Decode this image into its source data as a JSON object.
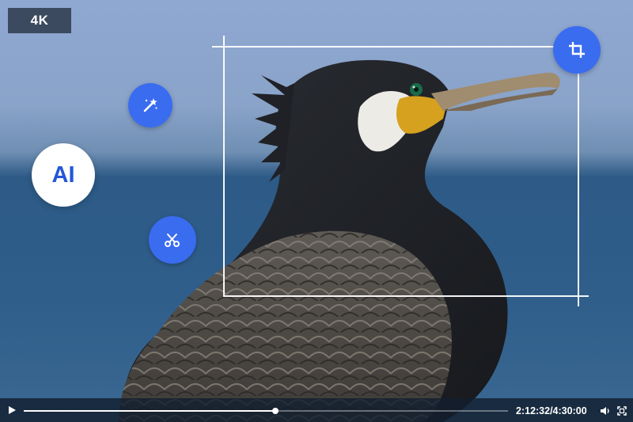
{
  "badge": {
    "quality": "4K"
  },
  "ai_button": {
    "label": "AI"
  },
  "tools": {
    "magic": "magic-wand-icon",
    "cut": "scissors-icon",
    "crop": "crop-icon"
  },
  "player": {
    "time": "2:12:32/4:30:00",
    "progress_fraction": 0.52
  },
  "colors": {
    "accent": "#3a6cf0",
    "ai_text": "#2456d8",
    "badge_bg": "#3b4a5e"
  }
}
